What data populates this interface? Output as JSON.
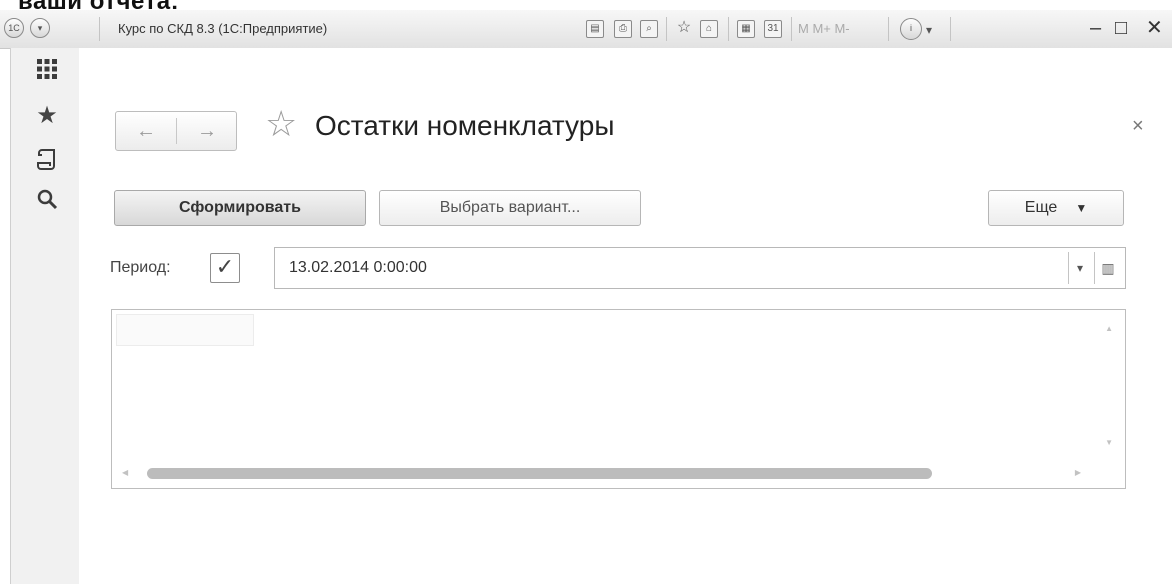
{
  "caption": "ваши отчета:",
  "titlebar": {
    "app_circle_label": "1С",
    "title": "Курс по СКД 8.3  (1С:Предприятие)",
    "memory_labels": "M  M+  M-",
    "info_icon": "info-icon",
    "minimize": "–",
    "maximize": "□",
    "close": "✕"
  },
  "nav": {
    "back": "←",
    "forward": "→"
  },
  "form": {
    "title": "Остатки номенклатуры",
    "close": "×"
  },
  "toolbar": {
    "generate": "Сформировать",
    "choose_variant": "Выбрать вариант...",
    "more": "Еще",
    "more_caret": "▼"
  },
  "period": {
    "label": "Период:",
    "checked": true,
    "checkmark": "✓",
    "value": "13.02.2014  0:00:00",
    "dropdown_glyph": "▾"
  },
  "icons": {
    "apps": "grid-icon",
    "favorites": "star-icon",
    "history": "history-icon",
    "search": "search-icon",
    "calendar": "calendar-icon"
  },
  "colors": {
    "window_bg": "#ffffff",
    "panel_bg": "#f1f1f1",
    "border": "#bdbdbd",
    "scroll_thumb": "#bcbcbc"
  }
}
